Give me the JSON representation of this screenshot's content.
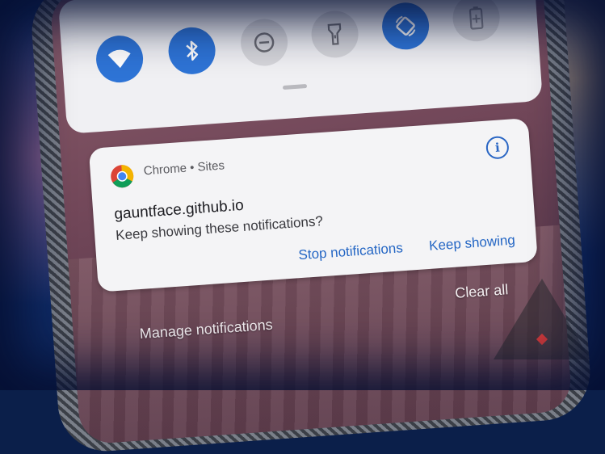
{
  "quick_settings": {
    "tiles": [
      {
        "icon": "wifi-icon",
        "state": "on"
      },
      {
        "icon": "bluetooth-icon",
        "state": "on"
      },
      {
        "icon": "do-not-disturb-icon",
        "state": "off"
      },
      {
        "icon": "flashlight-icon",
        "state": "off"
      },
      {
        "icon": "auto-rotate-icon",
        "state": "on"
      },
      {
        "icon": "battery-saver-icon",
        "state": "off"
      }
    ]
  },
  "notification": {
    "app": "Chrome • Sites",
    "title": "gauntface.github.io",
    "body": "Keep showing these notifications?",
    "actions": {
      "stop": "Stop notifications",
      "keep": "Keep showing"
    }
  },
  "shade": {
    "clear_all": "Clear all",
    "manage": "Manage notifications"
  },
  "colors": {
    "accent": "#2466c4",
    "tile_on": "#2e74d6",
    "tile_off": "#d6d6da",
    "card": "#f4f4f6"
  }
}
